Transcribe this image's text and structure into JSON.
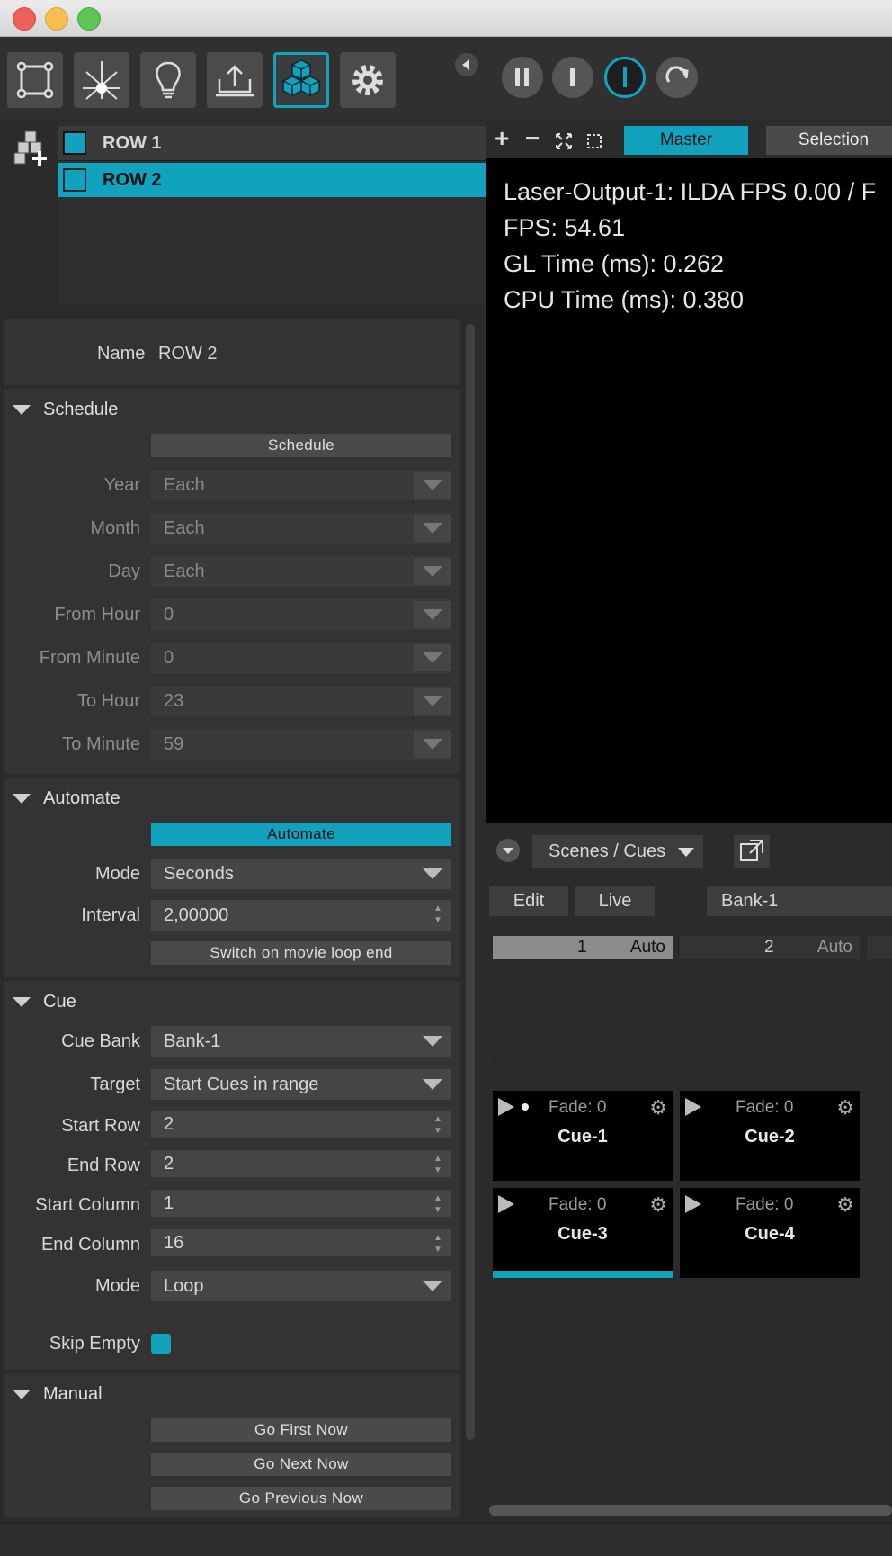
{
  "window": {
    "controls": [
      "close",
      "minimize",
      "maximize"
    ]
  },
  "toolbar": {
    "buttons": [
      "zones-icon",
      "laser-icon",
      "bulb-icon",
      "export-icon",
      "cubes-icon",
      "gear-icon"
    ],
    "active": "cubes-icon",
    "transport": [
      "pause-icon",
      "stop-icon",
      "power-icon",
      "redo-icon"
    ]
  },
  "rows": {
    "items": [
      {
        "label": "ROW 1",
        "selected": false
      },
      {
        "label": "ROW 2",
        "selected": true
      }
    ]
  },
  "properties": {
    "name_label": "Name",
    "name_value": "ROW 2",
    "schedule": {
      "header": "Schedule",
      "button": "Schedule",
      "fields": [
        {
          "label": "Year",
          "value": "Each"
        },
        {
          "label": "Month",
          "value": "Each"
        },
        {
          "label": "Day",
          "value": "Each"
        },
        {
          "label": "From Hour",
          "value": "0"
        },
        {
          "label": "From Minute",
          "value": "0"
        },
        {
          "label": "To Hour",
          "value": "23"
        },
        {
          "label": "To Minute",
          "value": "59"
        }
      ]
    },
    "automate": {
      "header": "Automate",
      "button": "Automate",
      "mode_label": "Mode",
      "mode_value": "Seconds",
      "interval_label": "Interval",
      "interval_value": "2,00000",
      "switch_button": "Switch on movie loop end"
    },
    "cue": {
      "header": "Cue",
      "fields": [
        {
          "label": "Cue Bank",
          "value": "Bank-1",
          "kind": "dropdown"
        },
        {
          "label": "Target",
          "value": "Start Cues in range",
          "kind": "dropdown"
        },
        {
          "label": "Start Row",
          "value": "2",
          "kind": "spin"
        },
        {
          "label": "End Row",
          "value": "2",
          "kind": "spin"
        },
        {
          "label": "Start Column",
          "value": "1",
          "kind": "spin"
        },
        {
          "label": "End Column",
          "value": "16",
          "kind": "spin"
        },
        {
          "label": "Mode",
          "value": "Loop",
          "kind": "dropdown"
        }
      ],
      "skip_empty_label": "Skip Empty",
      "skip_empty_checked": true
    },
    "manual": {
      "header": "Manual",
      "buttons": [
        "Go First Now",
        "Go Next Now",
        "Go Previous Now"
      ]
    }
  },
  "output": {
    "tabs": {
      "master": "Master",
      "selection": "Selection"
    },
    "lines": [
      "Laser-Output-1: ILDA FPS 0.00 / F",
      "FPS: 54.61",
      "GL Time (ms): 0.262",
      "CPU Time (ms): 0.380"
    ]
  },
  "cues_panel": {
    "dropdown": "Scenes / Cues",
    "edit": "Edit",
    "live": "Live",
    "bank": "Bank-1",
    "columns": [
      {
        "num": "1",
        "mode": "Auto"
      },
      {
        "num": "2",
        "mode": "Auto"
      }
    ],
    "cues": [
      {
        "fade": "Fade: 0",
        "name": "Cue-1"
      },
      {
        "fade": "Fade: 0",
        "name": "Cue-2"
      },
      {
        "fade": "Fade: 0",
        "name": "Cue-3"
      },
      {
        "fade": "Fade: 0",
        "name": "Cue-4"
      }
    ]
  },
  "colors": {
    "accent": "#11a3bd",
    "panel": "#333333",
    "background": "#2b2b2b"
  }
}
